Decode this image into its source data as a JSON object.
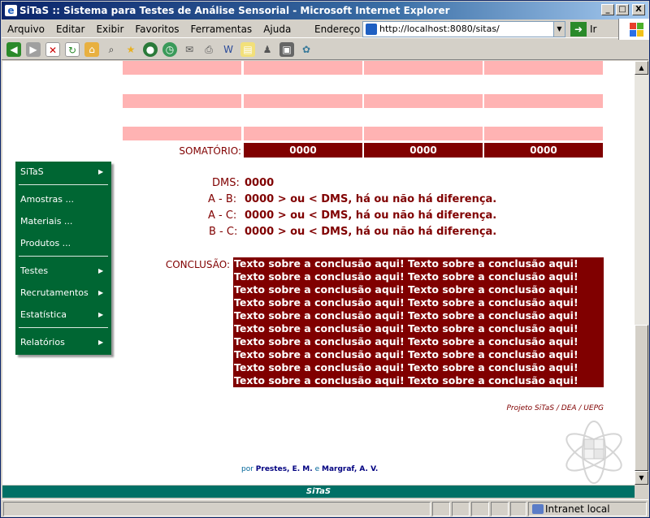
{
  "window": {
    "title": "SiTaS :: Sistema para Testes de Análise Sensorial - Microsoft Internet Explorer",
    "buttons": [
      "_",
      "□",
      "X"
    ]
  },
  "menubar": [
    "Arquivo",
    "Editar",
    "Exibir",
    "Favoritos",
    "Ferramentas",
    "Ajuda"
  ],
  "address": {
    "label": "Endereço",
    "url": "http://localhost:8080/sitas/",
    "go_label": "Ir"
  },
  "somatorio": {
    "label": "SOMATÓRIO:",
    "values": [
      "0000",
      "0000",
      "0000"
    ]
  },
  "sidemenu": {
    "items": [
      {
        "label": "SiTaS",
        "arrow": "▶"
      },
      {
        "label": "Amostras ...",
        "arrow": ""
      },
      {
        "label": "Materiais ...",
        "arrow": ""
      },
      {
        "label": "Produtos ...",
        "arrow": ""
      },
      {
        "label": "Testes",
        "arrow": "▶"
      },
      {
        "label": "Recrutamentos",
        "arrow": "▶"
      },
      {
        "label": "Estatística",
        "arrow": "▶"
      },
      {
        "label": "Relatórios",
        "arrow": "▶"
      }
    ]
  },
  "stats": {
    "dms": {
      "label": "DMS:",
      "value": "0000"
    },
    "rows": [
      {
        "label": "A - B:",
        "text": "0000 > ou < DMS, há ou não há diferença."
      },
      {
        "label": "A - C:",
        "text": "0000 > ou < DMS, há ou não há diferença."
      },
      {
        "label": "B - C:",
        "text": "0000 > ou < DMS, há ou não há diferença."
      }
    ]
  },
  "conclusao": {
    "label": "CONCLUSÃO:",
    "lines": [
      "Texto sobre a conclusão aqui! Texto sobre a conclusão aqui!",
      "Texto sobre a conclusão aqui! Texto sobre a conclusão aqui!",
      "Texto sobre a conclusão aqui! Texto sobre a conclusão aqui!",
      "Texto sobre a conclusão aqui! Texto sobre a conclusão aqui!",
      "Texto sobre a conclusão aqui! Texto sobre a conclusão aqui!",
      "Texto sobre a conclusão aqui! Texto sobre a conclusão aqui!",
      "Texto sobre a conclusão aqui! Texto sobre a conclusão aqui!",
      "Texto sobre a conclusão aqui! Texto sobre a conclusão aqui!",
      "Texto sobre a conclusão aqui! Texto sobre a conclusão aqui!",
      "Texto sobre a conclusão aqui! Texto sobre a conclusão aqui!"
    ]
  },
  "credits": {
    "project": "Projeto SiTaS / DEA / UEPG",
    "by": "por",
    "author1": "Prestes, E. M.",
    "and": "e",
    "author2": "Margraf, A. V."
  },
  "footer": {
    "text": "SiTaS"
  },
  "statusbar": {
    "zone": "Intranet local"
  },
  "colors": {
    "maroon": "#800000",
    "pink": "#ffb3b3",
    "green": "#006633",
    "teal": "#007066"
  }
}
